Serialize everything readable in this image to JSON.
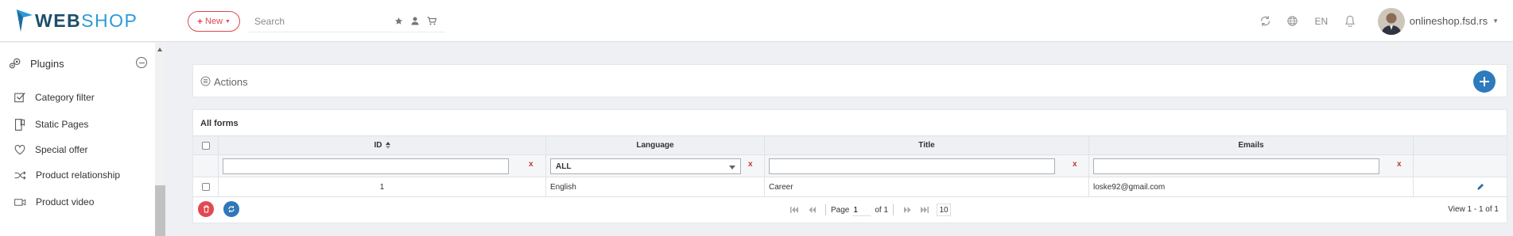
{
  "header": {
    "logo_part1": "WEB",
    "logo_part2": "SHOP",
    "new_button_label": "New",
    "search_placeholder": "Search",
    "language": "EN",
    "user_name": "onlineshop.fsd.rs"
  },
  "sidebar": {
    "section_label": "Plugins",
    "items": [
      {
        "label": "Category filter",
        "icon": "checkbox-icon"
      },
      {
        "label": "Static Pages",
        "icon": "bookmark-page-icon"
      },
      {
        "label": "Special offer",
        "icon": "heart-icon"
      },
      {
        "label": "Product relationship",
        "icon": "shuffle-icon"
      },
      {
        "label": "Product video",
        "icon": "video-icon"
      }
    ]
  },
  "actions": {
    "label": "Actions"
  },
  "grid": {
    "title": "All forms",
    "columns": [
      "ID",
      "Language",
      "Title",
      "Emails"
    ],
    "filters": {
      "language_selected": "ALL",
      "clear_symbol": "x"
    },
    "rows": [
      {
        "id": "1",
        "language": "English",
        "title": "Career",
        "emails": "loske92@gmail.com"
      }
    ],
    "pager": {
      "page_label": "Page",
      "page_value": "1",
      "of_label": "of 1",
      "page_size": "10",
      "view_text": "View 1 - 1 of 1"
    }
  },
  "colors": {
    "brand_dark": "#1d4f6b",
    "brand_light": "#2b9ad9",
    "accent_red": "#e0474c",
    "accent_blue": "#2d7bbd"
  }
}
